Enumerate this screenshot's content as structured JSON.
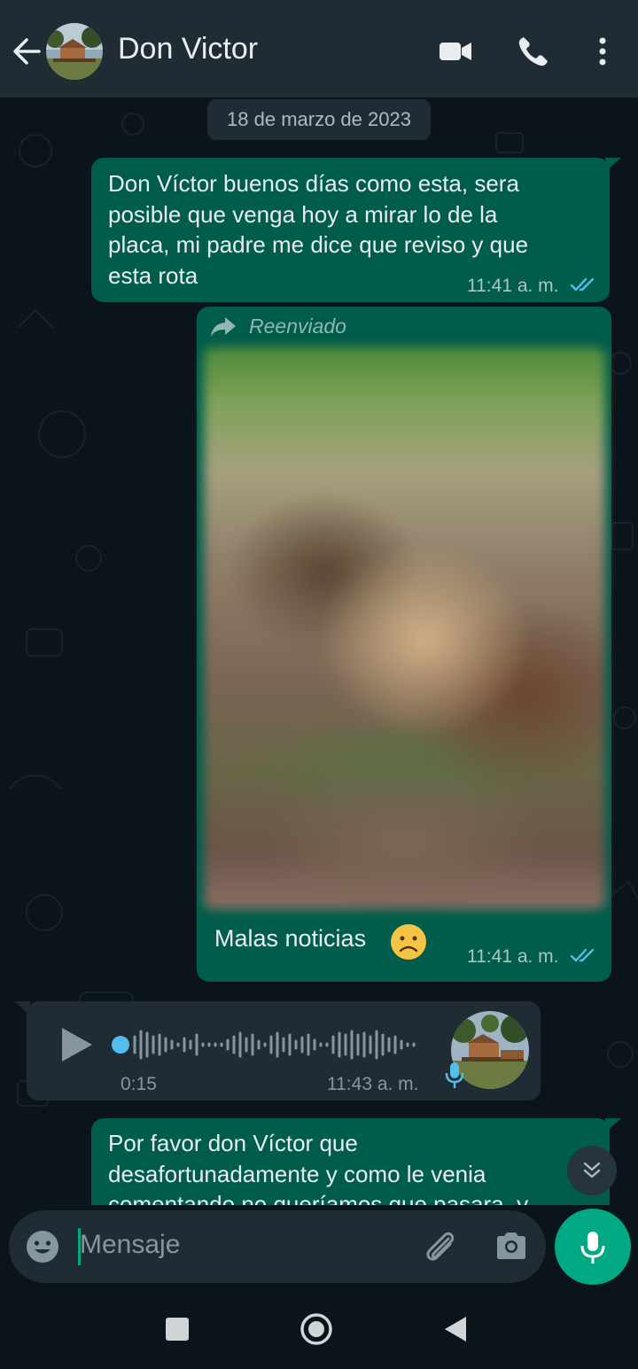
{
  "header": {
    "contact_name": "Don Victor",
    "icons": [
      "back-arrow-icon",
      "video-call-icon",
      "voice-call-icon",
      "more-options-icon"
    ]
  },
  "chat": {
    "date_label": "18 de marzo de 2023",
    "messages": [
      {
        "direction": "outgoing",
        "text_lines": [
          "Don Víctor buenos días como esta, sera",
          "posible que venga hoy a mirar lo de la",
          "placa, mi padre me dice que reviso y que",
          "esta rota"
        ],
        "time": "11:41 a. m.",
        "status": "read"
      },
      {
        "direction": "outgoing",
        "forwarded_label": "Reenviado",
        "has_image": true,
        "caption": "Malas noticias",
        "caption_emoji": "☹️",
        "time": "11:41 a. m.",
        "status": "read"
      },
      {
        "direction": "incoming",
        "type": "voice",
        "duration": "0:15",
        "time": "11:43 a. m."
      },
      {
        "direction": "outgoing",
        "text_lines": [
          "Por favor don Víctor que",
          "desafortunadamente y como le venia",
          "comentando no queríamos que pasara, y"
        ]
      }
    ]
  },
  "composer": {
    "placeholder": "Mensaje",
    "icons": [
      "emoji-icon",
      "attach-icon",
      "camera-icon",
      "mic-icon"
    ]
  },
  "colors": {
    "background": "#0b141a",
    "header": "#1f2c34",
    "outgoing_bubble": "#005c4b",
    "incoming_bubble": "#1f2c34",
    "accent": "#00a884",
    "read_ticks": "#53bdeb"
  }
}
